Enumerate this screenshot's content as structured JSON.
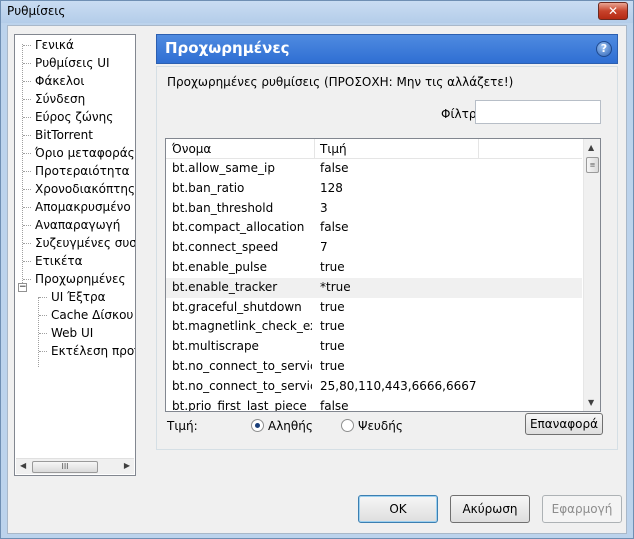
{
  "window": {
    "title": "Ρυθμίσεις",
    "close_glyph": "✕"
  },
  "tree": {
    "items": [
      {
        "label": "Γενικά"
      },
      {
        "label": "Ρυθμίσεις UI"
      },
      {
        "label": "Φάκελοι"
      },
      {
        "label": "Σύνδεση"
      },
      {
        "label": "Εύρος ζώνης"
      },
      {
        "label": "BitTorrent"
      },
      {
        "label": "Όριο μεταφοράς"
      },
      {
        "label": "Προτεραιότητα"
      },
      {
        "label": "Χρονοδιακόπτης"
      },
      {
        "label": "Απομακρυσμένο"
      },
      {
        "label": "Αναπαραγωγή"
      },
      {
        "label": "Συζευγμένες συσκ"
      },
      {
        "label": "Ετικέτα"
      },
      {
        "label": "Προχωρημένες"
      }
    ],
    "children": [
      {
        "label": "UI Έξτρα"
      },
      {
        "label": "Cache Δίσκου"
      },
      {
        "label": "Web UI"
      },
      {
        "label": "Εκτέλεση προγρ"
      }
    ],
    "expander_glyph": "−",
    "scroll_left": "◀",
    "scroll_right": "▶",
    "scroll_thumb": "III"
  },
  "header": {
    "title": "Προχωρημένες",
    "help_glyph": "?"
  },
  "group": {
    "caption": "Προχωρημένες ρυθμίσεις (ΠΡΟΣΟΧΗ: Μην τις αλλάζετε!)",
    "filter_label": "Φίλτρο",
    "filter_value": ""
  },
  "table": {
    "col_name": "Όνομα",
    "col_value": "Τιμή",
    "rows": [
      {
        "name": "bt.allow_same_ip",
        "value": "false"
      },
      {
        "name": "bt.ban_ratio",
        "value": "128"
      },
      {
        "name": "bt.ban_threshold",
        "value": "3"
      },
      {
        "name": "bt.compact_allocation",
        "value": "false"
      },
      {
        "name": "bt.connect_speed",
        "value": "7"
      },
      {
        "name": "bt.enable_pulse",
        "value": "true"
      },
      {
        "name": "bt.enable_tracker",
        "value": "*true"
      },
      {
        "name": "bt.graceful_shutdown",
        "value": "true"
      },
      {
        "name": "bt.magnetlink_check_exi...",
        "value": "true"
      },
      {
        "name": "bt.multiscrape",
        "value": "true"
      },
      {
        "name": "bt.no_connect_to_services",
        "value": "true"
      },
      {
        "name": "bt.no_connect_to_service...",
        "value": "25,80,110,443,6666,6667"
      },
      {
        "name": "bt.prio_first_last_piece",
        "value": "false"
      }
    ],
    "scroll_up": "▲",
    "scroll_down": "▼",
    "scroll_thumb": "≡"
  },
  "value_editor": {
    "label": "Τιμή:",
    "true_label": "Αληθής",
    "false_label": "Ψευδής",
    "selected": "true",
    "reset_label": "Επαναφορά"
  },
  "footer": {
    "ok_label": "OK",
    "cancel_label": "Ακύρωση",
    "apply_label": "Εφαρμογή"
  }
}
